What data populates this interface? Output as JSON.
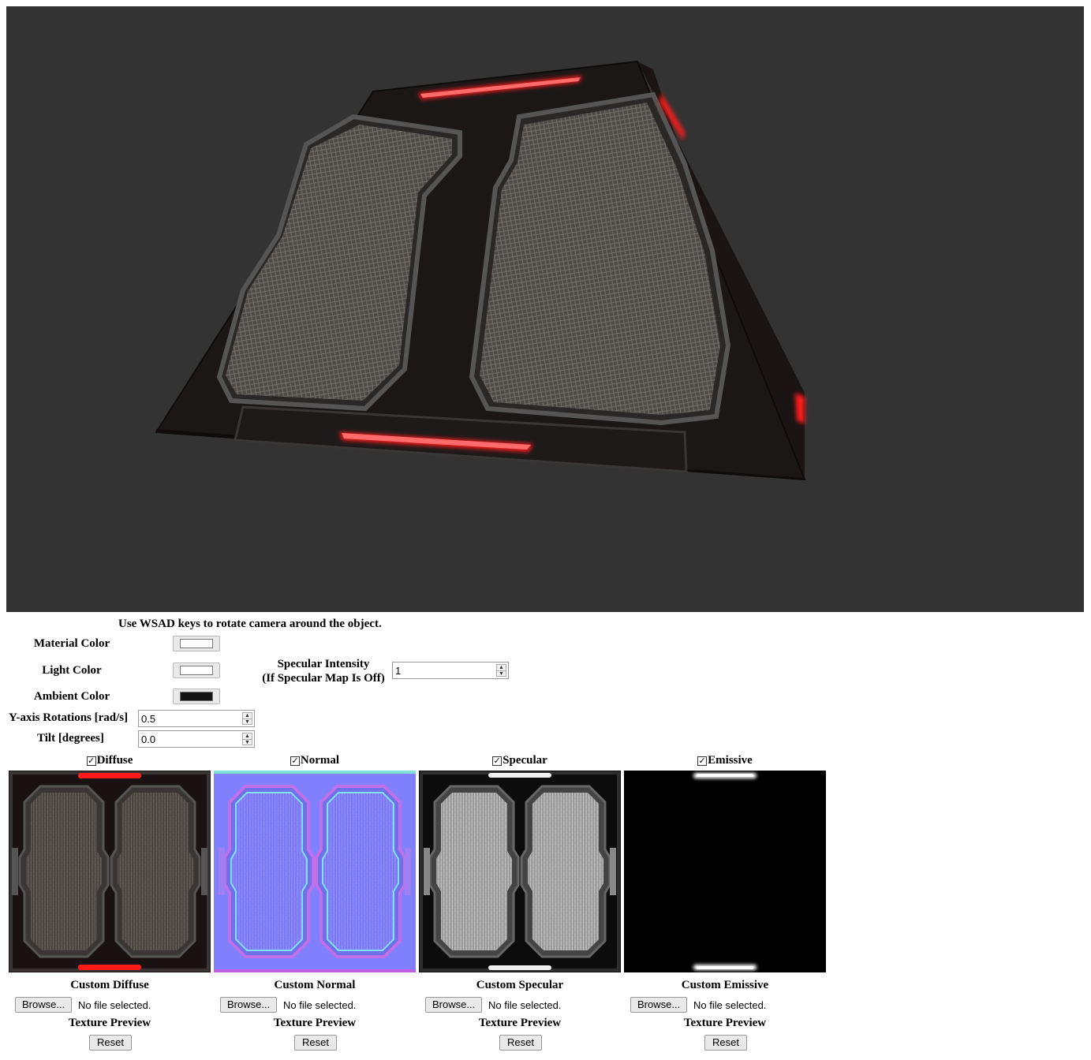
{
  "hint": "Use WSAD keys to rotate camera around the object.",
  "controls": {
    "material_color": {
      "label": "Material Color",
      "value": "#ffffff"
    },
    "light_color": {
      "label": "Light Color",
      "value": "#ffffff"
    },
    "ambient_color": {
      "label": "Ambient Color",
      "value": "#141414"
    },
    "specular_intensity": {
      "label_line1": "Specular Intensity",
      "label_line2": "(If Specular Map Is Off)",
      "value": "1"
    },
    "y_rotation": {
      "label": "Y-axis Rotations [rad/s]",
      "value": "0.5"
    },
    "tilt": {
      "label": "Tilt [degrees]",
      "value": "0.0"
    }
  },
  "maps": [
    {
      "name": "Diffuse",
      "checked": true,
      "custom_label": "Custom Diffuse",
      "browse_label": "Browse...",
      "file_status": "No file selected.",
      "preview_label": "Texture Preview",
      "reset_label": "Reset"
    },
    {
      "name": "Normal",
      "checked": true,
      "custom_label": "Custom Normal",
      "browse_label": "Browse...",
      "file_status": "No file selected.",
      "preview_label": "Texture Preview",
      "reset_label": "Reset"
    },
    {
      "name": "Specular",
      "checked": true,
      "custom_label": "Custom Specular",
      "browse_label": "Browse...",
      "file_status": "No file selected.",
      "preview_label": "Texture Preview",
      "reset_label": "Reset"
    },
    {
      "name": "Emissive",
      "checked": true,
      "custom_label": "Custom Emissive",
      "browse_label": "Browse...",
      "file_status": "No file selected.",
      "preview_label": "Texture Preview",
      "reset_label": "Reset"
    }
  ],
  "colors": {
    "viewport_bg": "#333333",
    "emissive_red": "#ff1a1a",
    "normal_blue": "#8080ff"
  }
}
